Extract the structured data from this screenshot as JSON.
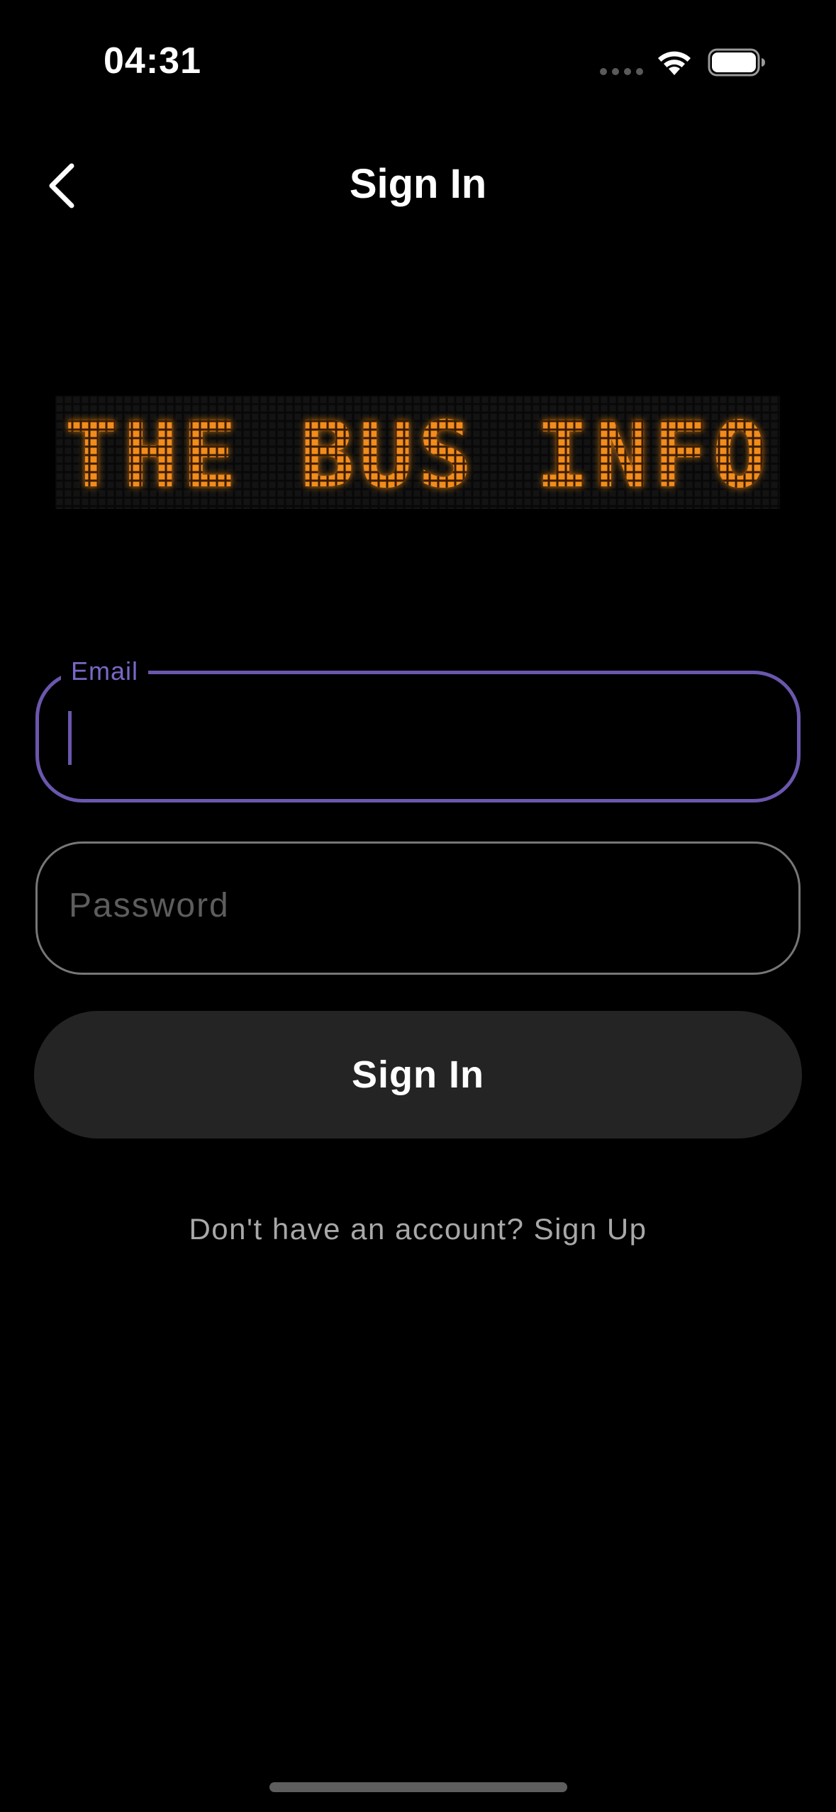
{
  "status_bar": {
    "time": "04:31"
  },
  "nav": {
    "title": "Sign In",
    "back_icon": "chevron-left-icon"
  },
  "logo": {
    "text": "THE BUS INFO",
    "color": "#f28c1e"
  },
  "form": {
    "email": {
      "label": "Email",
      "value": ""
    },
    "password": {
      "placeholder": "Password",
      "value": ""
    },
    "submit_label": "Sign In",
    "signup_text": "Don't have an account? Sign Up"
  },
  "colors": {
    "accent": "#6a57ad",
    "background": "#000000",
    "button": "#242424"
  }
}
